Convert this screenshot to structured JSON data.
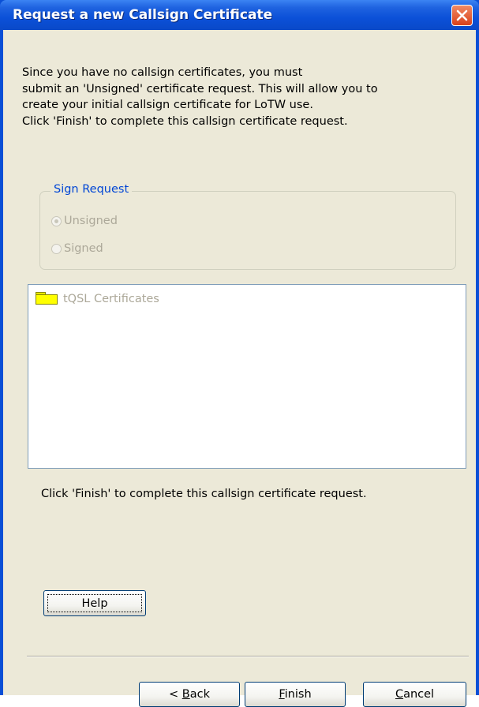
{
  "window": {
    "title": "Request a new Callsign Certificate",
    "close_icon": "close-x-icon"
  },
  "intro_lines": [
    "Since you have no callsign certificates, you must",
    "submit an 'Unsigned' certificate request. This will allow you to",
    "create your initial callsign certificate for LoTW use.",
    "Click 'Finish' to complete this callsign certificate request."
  ],
  "sign_request": {
    "legend": "Sign Request",
    "options": [
      {
        "label": "Unsigned",
        "checked": true,
        "enabled": false
      },
      {
        "label": "Signed",
        "checked": false,
        "enabled": false
      }
    ]
  },
  "tree": {
    "items": [
      {
        "label": "tQSL Certificates",
        "icon": "folder-icon"
      }
    ]
  },
  "finish_note": "Click 'Finish' to complete this callsign certificate request.",
  "buttons": {
    "help": "Help",
    "back_prefix": "< ",
    "back_mnemonic": "B",
    "back_rest": "ack",
    "finish_mnemonic": "F",
    "finish_rest": "inish",
    "cancel_mnemonic": "C",
    "cancel_rest": "ancel"
  },
  "colors": {
    "titlebar": "#0a4fd6",
    "dialog_bg": "#ece9d8",
    "legend": "#0046d5",
    "disabled_text": "#aca899",
    "close_button": "#d8411b"
  }
}
